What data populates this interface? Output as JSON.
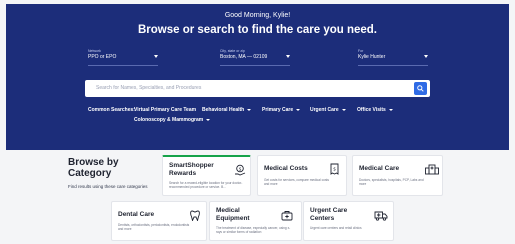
{
  "header": {
    "greeting": "Good Morning, Kylie!",
    "headline": "Browse or search to find the care you need."
  },
  "filters": {
    "network": {
      "caption": "Network",
      "value": "PPO or EPO"
    },
    "location": {
      "caption": "City, state or zip",
      "value": "Boston, MA — 02109"
    },
    "member": {
      "caption": "For",
      "value": "Kylie Hunter"
    }
  },
  "search": {
    "placeholder": "Search for Names, Specialties, and Procedures"
  },
  "common_searches": {
    "label": "Common Searches:",
    "items": [
      {
        "label": "Virtual Primary Care Team"
      },
      {
        "label": "Behavioral Health"
      },
      {
        "label": "Primary Care"
      },
      {
        "label": "Urgent Care"
      },
      {
        "label": "Office Visits"
      },
      {
        "label": "Colonoscopy & Mammogram"
      }
    ]
  },
  "browse": {
    "title": "Browse by Category",
    "subtitle": "Find results using these care categories"
  },
  "categories": [
    {
      "title": "SmartShopper Rewards",
      "desc": "Search for a reward-eligible location for your doctor-recommended procedure or service. B...",
      "icon": "dollar-hand-icon"
    },
    {
      "title": "Medical Costs",
      "desc": "Get costs for services, compare medical costs and more",
      "icon": "receipt-dollar-icon"
    },
    {
      "title": "Medical Care",
      "desc": "Doctors, specialists, hospitals, PCP, Labs and more",
      "icon": "hospital-icon"
    },
    {
      "title": "Dental Care",
      "desc": "Dentists, orthodontists, periodontists, endodontists and more",
      "icon": "tooth-icon"
    },
    {
      "title": "Medical Equipment",
      "desc": "The treatment of disease, especially cancer, using x-rays or similar forms of radiation",
      "icon": "medical-box-icon"
    },
    {
      "title": "Urgent Care Centers",
      "desc": "Urgent care centers and retail clinics",
      "icon": "ambulance-icon"
    }
  ],
  "colors": {
    "hero_bg": "#1c2d7a",
    "search_button": "#2f6be5",
    "featured_accent": "#16a34a"
  }
}
